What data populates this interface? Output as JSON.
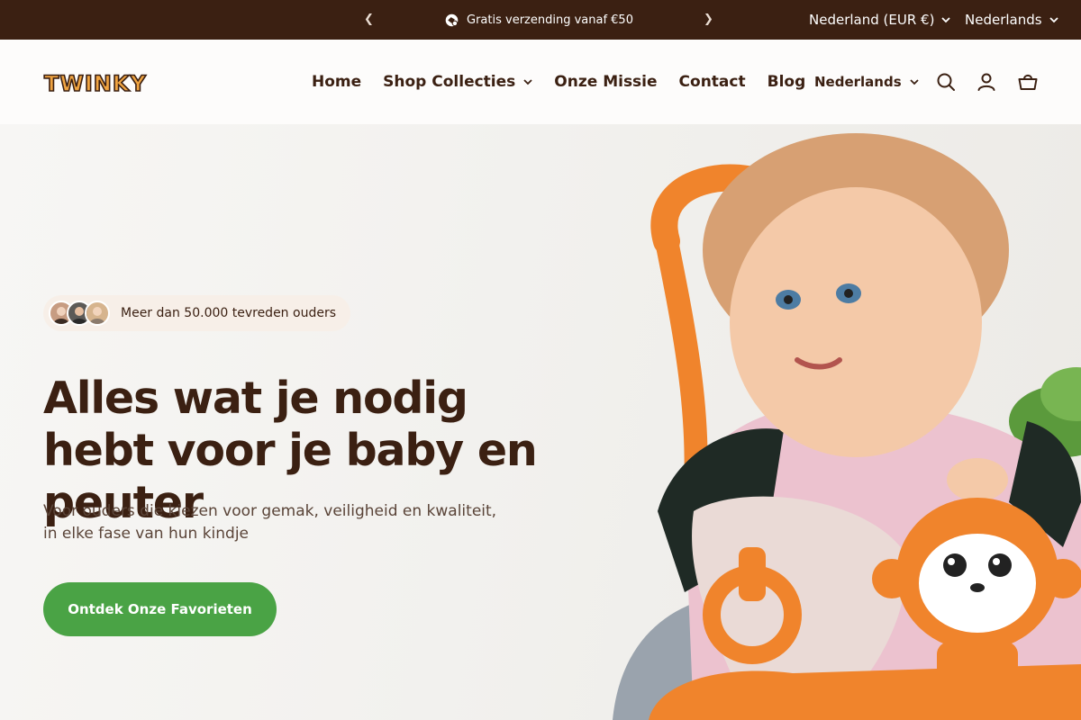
{
  "announcement": {
    "message": "Gratis verzending vanaf €50",
    "prev_icon": "chevron-left-icon",
    "next_icon": "chevron-right-icon",
    "country_selector": "Nederland (EUR €)",
    "language_selector": "Nederlands"
  },
  "header": {
    "logo_text": "TWINKY",
    "nav": [
      {
        "label": "Home"
      },
      {
        "label": "Shop Collecties",
        "has_dropdown": true
      },
      {
        "label": "Onze Missie"
      },
      {
        "label": "Contact"
      },
      {
        "label": "Blog"
      }
    ],
    "language": "Nederlands",
    "icons": [
      "search-icon",
      "account-icon",
      "cart-icon"
    ]
  },
  "hero": {
    "social_proof": "Meer dan 50.000 tevreden ouders",
    "headline": "Alles wat je nodig hebt voor je baby en peuter",
    "subtext": "Voor ouders die kiezen voor gemak, veiligheid en kwaliteit, in elke fase van hun kindje",
    "cta_label": "Ontdek Onze Favorieten"
  },
  "colors": {
    "brand_dark": "#3b2012",
    "cta_green": "#4aa345",
    "logo_orange": "#f0a441"
  }
}
